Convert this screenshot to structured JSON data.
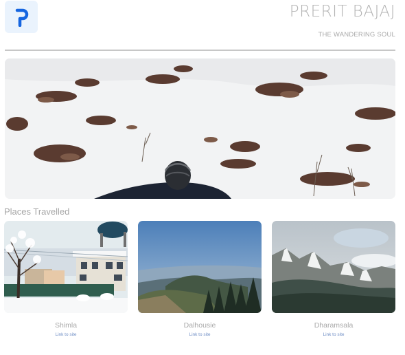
{
  "header": {
    "title": "PRERIT BAJAJ",
    "subtitle": "THE WANDERING SOUL",
    "logo_icon": "p-logo-icon",
    "logo_color": "#1565e0"
  },
  "hero": {
    "image": "snowy-hillside-photo"
  },
  "places": {
    "heading": "Places Travelled",
    "items": [
      {
        "name": "Shimla",
        "link_label": "Link to site",
        "image": "snowy-town-photo"
      },
      {
        "name": "Dalhousie",
        "link_label": "Link to site",
        "image": "mountain-valley-photo"
      },
      {
        "name": "Dharamsala",
        "link_label": "Link to site",
        "image": "snow-capped-range-photo"
      }
    ]
  }
}
